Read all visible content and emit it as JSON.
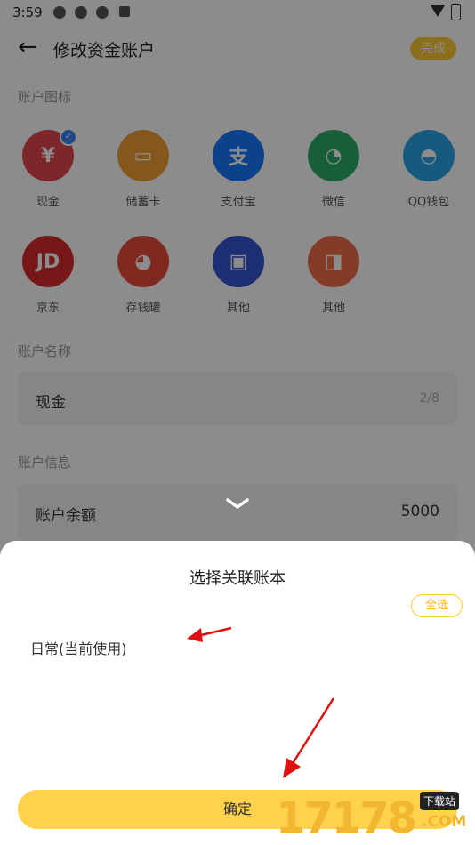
{
  "status_bar": {
    "time": "3:59"
  },
  "header": {
    "back_icon": "arrow-left-icon",
    "title": "修改资金账户",
    "done_label": "完成"
  },
  "icons_section": {
    "label": "账户图标",
    "items": [
      {
        "name": "cash",
        "label": "现金",
        "color": "#e5484d",
        "glyph": "¥",
        "selected": true
      },
      {
        "name": "debit-card",
        "label": "储蓄卡",
        "color": "#f0a030",
        "glyph": "▭"
      },
      {
        "name": "alipay",
        "label": "支付宝",
        "color": "#1677ff",
        "glyph": "支"
      },
      {
        "name": "wechat",
        "label": "微信",
        "color": "#2aae67",
        "glyph": "◔"
      },
      {
        "name": "qq-wallet",
        "label": "QQ钱包",
        "color": "#2ba4e8",
        "glyph": "◓"
      },
      {
        "name": "jd",
        "label": "京东",
        "color": "#d92c2c",
        "glyph": "JD"
      },
      {
        "name": "piggy-bank",
        "label": "存钱罐",
        "color": "#e94b3c",
        "glyph": "◕"
      },
      {
        "name": "safe",
        "label": "其他",
        "color": "#3554d1",
        "glyph": "▣"
      },
      {
        "name": "wallet",
        "label": "其他",
        "color": "#f06e4a",
        "glyph": "◨"
      }
    ]
  },
  "name_section": {
    "label": "账户名称",
    "value": "现金",
    "counter": "2/8"
  },
  "info_section": {
    "label": "账户信息",
    "balance_label": "账户余额",
    "balance_value": "5000"
  },
  "sheet": {
    "title": "选择关联账本",
    "select_all_label": "全选",
    "books": [
      "日常(当前使用)"
    ],
    "confirm_label": "确定"
  },
  "watermark": {
    "text": "17178",
    "badge": "下载站",
    "domain": ".COM"
  },
  "colors": {
    "accent": "#ffc93a",
    "confirm": "#ffd24d",
    "overlay": "rgba(0,0,0,0.45)"
  }
}
